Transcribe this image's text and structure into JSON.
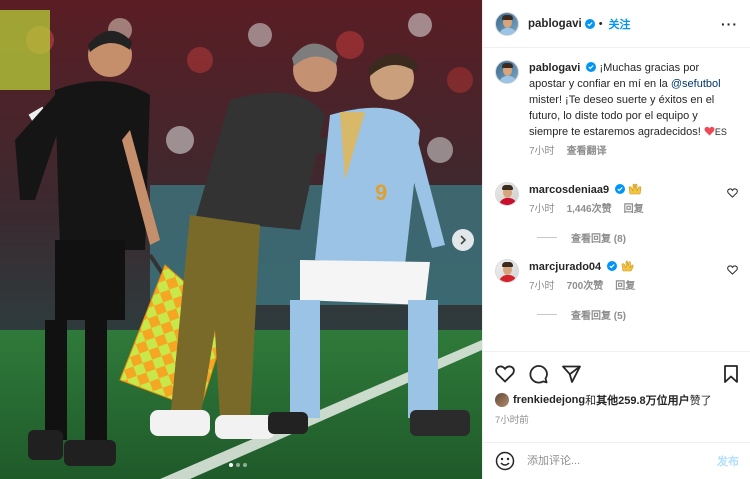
{
  "photo": {
    "jersey_number": "9",
    "next_icon": "chevron-right-icon",
    "carousel": {
      "total": 3,
      "active": 1
    }
  },
  "post": {
    "username": "pablogavi",
    "follow_label": "关注",
    "more_label": "···"
  },
  "caption": {
    "username": "pablogavi",
    "text_before": "¡Muchas gracias por apostar y confiar en mí en la ",
    "mention": "@sefutbol",
    "text_after": " mister! ¡Te deseo suerte y éxitos en el futuro, lo diste todo por el equipo y siempre te estaremos agradecidos! ",
    "suffix": "ES",
    "time": "7小时",
    "translate_label": "查看翻译"
  },
  "comments": [
    {
      "username": "marcosdeniaa9",
      "emoji": "clapping-hands-icon",
      "time": "7小时",
      "likes": "1,446次赞",
      "reply_label": "回复",
      "view_replies": "查看回复 (8)"
    },
    {
      "username": "marcjurado04",
      "emoji": "clapping-hand-icon",
      "time": "7小时",
      "likes": "700次赞",
      "reply_label": "回复",
      "view_replies": "查看回复 (5)"
    }
  ],
  "likes": {
    "user": "frenkiedejong",
    "middle": "和",
    "others": "其他259.8万位用户",
    "end": "赞了"
  },
  "posted_ago": "7小时前",
  "add_comment": {
    "placeholder": "添加评论...",
    "post_label": "发布"
  },
  "colors": {
    "accent": "#0095f6",
    "heart": "#ed4956",
    "verified": "#0095f6"
  }
}
